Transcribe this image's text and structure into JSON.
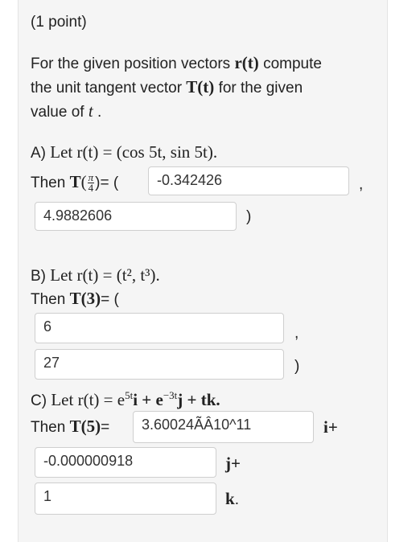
{
  "header": {
    "points": "(1 point)"
  },
  "intro": {
    "line1_a": "For the given position vectors",
    "line1_b": "compute",
    "line2_a": "the unit tangent vector",
    "line2_b": "for the given",
    "line3": "value of",
    "r_t": "r(t)",
    "T_t": "T(t)",
    "t": "t",
    "period": "."
  },
  "partA": {
    "label": "A)",
    "let": "Let",
    "r_def": "r(t) = (cos 5t, sin 5t).",
    "then": "Then",
    "T": "T",
    "pi": "π",
    "four": "4",
    "eq_open": ")= (",
    "input1": "-0.342426",
    "comma": ",",
    "input2": "4.9882606",
    "close": ")"
  },
  "partB": {
    "label": "B)",
    "let": "Let",
    "r_def": "r(t) = (t², t³).",
    "then": "Then",
    "T3": "T(3)",
    "eq_open": "= (",
    "input1": "6",
    "comma": ",",
    "input2": "27",
    "close": ")"
  },
  "partC": {
    "label": "C)",
    "let": "Let",
    "r_def_a": "r(t) = e",
    "exp1": "5t",
    "r_def_b": "i + e",
    "exp2": "−3t",
    "r_def_c": "j + tk.",
    "then": "Then",
    "T5": "T(5)",
    "eq": "=",
    "input1": "3.60024ÃÂ10^11",
    "i_plus": "i+",
    "input2": "-0.000000918",
    "j_plus": "j+",
    "input3": "1",
    "k_end": "k",
    "dot": "."
  }
}
